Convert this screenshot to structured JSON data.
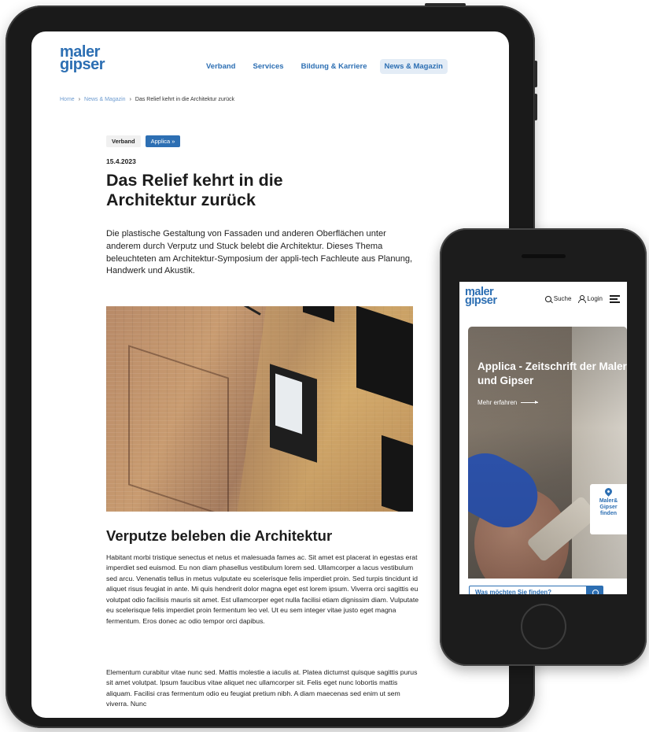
{
  "tablet": {
    "logo": {
      "line1": "maler",
      "line2": "gipser"
    },
    "nav": [
      {
        "label": "Verband"
      },
      {
        "label": "Services"
      },
      {
        "label": "Bildung & Karriere"
      },
      {
        "label": "News & Magazin",
        "active": true
      }
    ],
    "breadcrumb": {
      "home": "Home",
      "section": "News & Magazin",
      "current": "Das Relief kehrt in die Architektur zurück"
    },
    "tags": [
      {
        "label": "Verband"
      },
      {
        "label": "Applica »"
      }
    ],
    "article": {
      "date": "15.4.2023",
      "title": "Das Relief kehrt in die Architektur zurück",
      "lead": "Die plastische Gestaltung von Fassaden und anderen Oberflächen unter anderem durch Verputz und Stuck belebt die Architektur. Dieses Thema beleuchteten am Architektur-Symposium der appli-tech Fachleute aus Planung, Handwerk und Akustik.",
      "heading2": "Verputze beleben die Architektur",
      "paragraph1": "Habitant morbi tristique senectus et netus et malesuada fames ac. Sit amet est placerat in egestas erat imperdiet sed euismod. Eu non diam phasellus vestibulum lorem sed. Ullamcorper a lacus vestibulum sed arcu. Venenatis tellus in metus vulputate eu scelerisque felis imperdiet proin. Sed turpis tincidunt id aliquet risus feugiat in ante. Mi quis hendrerit dolor magna eget est lorem ipsum. Viverra orci sagittis eu volutpat odio facilisis mauris sit amet. Est ullamcorper eget nulla facilisi etiam dignissim diam. Vulputate eu scelerisque felis imperdiet proin fermentum leo vel. Ut eu sem integer vitae justo eget magna fermentum. Eros donec ac odio tempor orci dapibus.",
      "paragraph2": "Elementum curabitur vitae nunc sed. Mattis molestie a iaculis at. Platea dictumst quisque sagittis purus sit amet volutpat. Ipsum faucibus vitae aliquet nec ullamcorper sit. Felis eget nunc lobortis mattis aliquam. Facilisi cras fermentum odio eu feugiat pretium nibh. A diam maecenas sed enim ut sem viverra. Nunc"
    }
  },
  "phone": {
    "logo": {
      "line1": "maler",
      "line2": "gipser"
    },
    "search_label": "Suche",
    "login_label": "Login",
    "hero": {
      "title": "Applica - Zeitschrift der Maler und Gipser",
      "link": "Mehr erfahren"
    },
    "finder": {
      "line1": "Maler&",
      "line2": "Gipser",
      "line3": "finden"
    },
    "search_placeholder": "Was möchten Sie finden?"
  },
  "colors": {
    "brand_blue": "#2d6fb3",
    "nav_active_bg": "#e3ecf6"
  },
  "icons": [
    "search-icon",
    "user-icon",
    "menu-icon",
    "pin-icon",
    "arrow-right-icon"
  ]
}
